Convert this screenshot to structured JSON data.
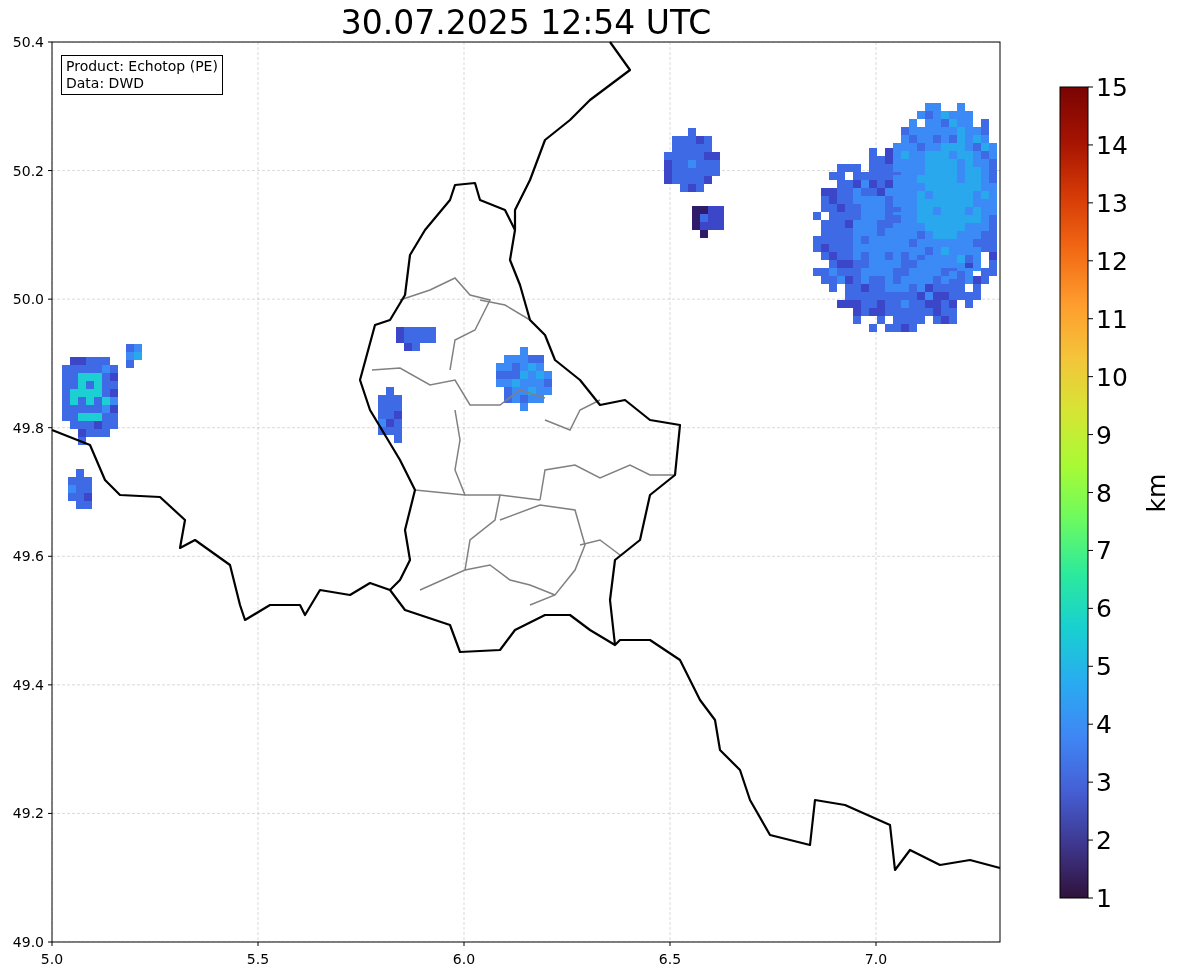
{
  "title": "30.07.2025 12:54 UTC",
  "legend": {
    "lines": [
      "Product: Echotop (PE)",
      "Data: DWD"
    ]
  },
  "x_ticks": [
    "5.0",
    "5.5",
    "6.0",
    "6.5",
    "7.0"
  ],
  "y_ticks": [
    "50.4",
    "50.2",
    "50.0",
    "49.8",
    "49.6",
    "49.4",
    "49.2",
    "49.0"
  ],
  "colorbar": {
    "label": "km",
    "ticks": [
      "15",
      "14",
      "13",
      "12",
      "11",
      "10",
      "9",
      "8",
      "7",
      "6",
      "5",
      "4",
      "3",
      "2",
      "1"
    ]
  }
}
